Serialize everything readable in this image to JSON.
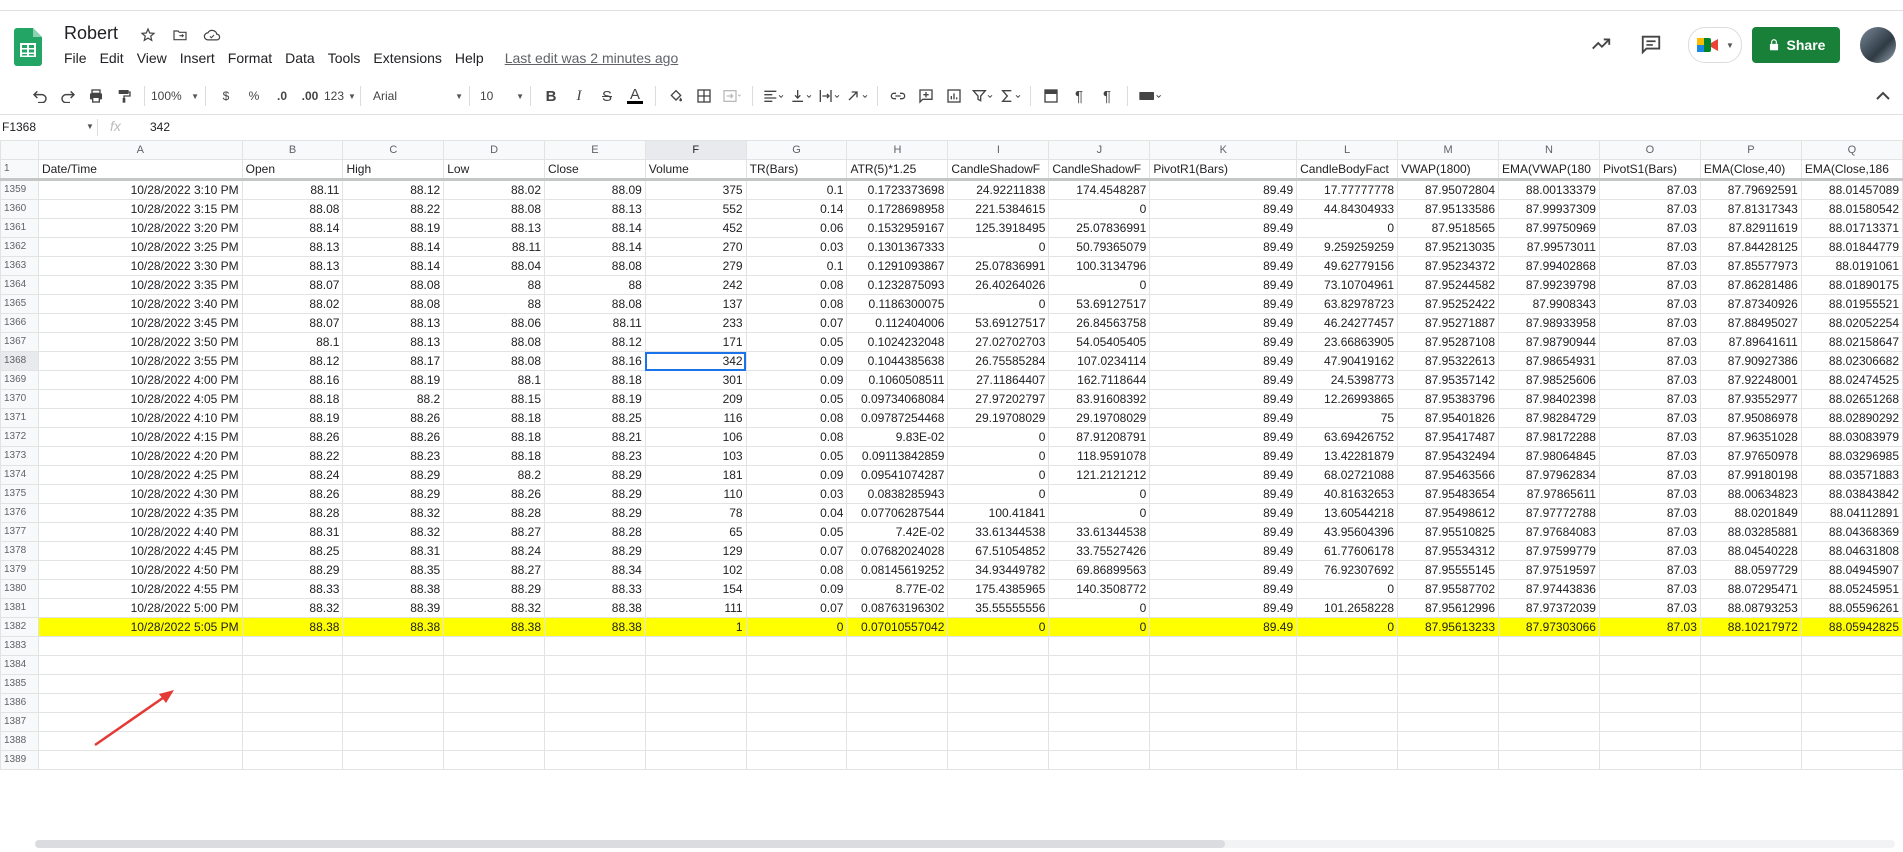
{
  "doc": {
    "title": "Robert",
    "menus": [
      "File",
      "Edit",
      "View",
      "Insert",
      "Format",
      "Data",
      "Tools",
      "Extensions",
      "Help"
    ],
    "last_edit": "Last edit was 2 minutes ago",
    "share_label": "Share"
  },
  "toolbar": {
    "zoom": "100%",
    "currency": "$",
    "percent": "%",
    "dec_decrease": ".0",
    "dec_increase": ".00",
    "more_formats": "123",
    "font": "Arial",
    "font_size": "10"
  },
  "formula_bar": {
    "cell_ref": "F1368",
    "fx": "fx",
    "value": "342"
  },
  "colors": {
    "share_green": "#188038",
    "highlight_yellow": "#ffff00",
    "selection_blue": "#1a73e8",
    "annotation_red": "#e53935"
  },
  "sheet": {
    "column_letters": [
      "A",
      "B",
      "C",
      "D",
      "E",
      "F",
      "G",
      "H",
      "I",
      "J",
      "K",
      "L",
      "M",
      "N",
      "O",
      "P",
      "Q"
    ],
    "header_row_number": "1",
    "headers": [
      "Date/Time",
      "Open",
      "High",
      "Low",
      "Close",
      "Volume",
      "TR(Bars)",
      "ATR(5)*1.25",
      "CandleShadowF",
      "CandleShadowF",
      "PivotR1(Bars)",
      "CandleBodyFact",
      "VWAP(1800)",
      "EMA(VWAP(180",
      "PivotS1(Bars)",
      "EMA(Close,40)",
      "EMA(Close,186"
    ],
    "rows": [
      {
        "n": "1359",
        "c": [
          "10/28/2022 3:10 PM",
          "88.11",
          "88.12",
          "88.02",
          "88.09",
          "375",
          "0.1",
          "0.1723373698",
          "24.92211838",
          "174.4548287",
          "89.49",
          "17.77777778",
          "87.95072804",
          "88.00133379",
          "87.03",
          "87.79692591",
          "88.01457089"
        ]
      },
      {
        "n": "1360",
        "c": [
          "10/28/2022 3:15 PM",
          "88.08",
          "88.22",
          "88.08",
          "88.13",
          "552",
          "0.14",
          "0.1728698958",
          "221.5384615",
          "0",
          "89.49",
          "44.84304933",
          "87.95133586",
          "87.99937309",
          "87.03",
          "87.81317343",
          "88.01580542"
        ]
      },
      {
        "n": "1361",
        "c": [
          "10/28/2022 3:20 PM",
          "88.14",
          "88.19",
          "88.13",
          "88.14",
          "452",
          "0.06",
          "0.1532959167",
          "125.3918495",
          "25.07836991",
          "89.49",
          "0",
          "87.9518565",
          "87.99750969",
          "87.03",
          "87.82911619",
          "88.01713371"
        ]
      },
      {
        "n": "1362",
        "c": [
          "10/28/2022 3:25 PM",
          "88.13",
          "88.14",
          "88.11",
          "88.14",
          "270",
          "0.03",
          "0.1301367333",
          "0",
          "50.79365079",
          "89.49",
          "9.259259259",
          "87.95213035",
          "87.99573011",
          "87.03",
          "87.84428125",
          "88.01844779"
        ]
      },
      {
        "n": "1363",
        "c": [
          "10/28/2022 3:30 PM",
          "88.13",
          "88.14",
          "88.04",
          "88.08",
          "279",
          "0.1",
          "0.1291093867",
          "25.07836991",
          "100.3134796",
          "89.49",
          "49.62779156",
          "87.95234372",
          "87.99402868",
          "87.03",
          "87.85577973",
          "88.0191061"
        ]
      },
      {
        "n": "1364",
        "c": [
          "10/28/2022 3:35 PM",
          "88.07",
          "88.08",
          "88",
          "88",
          "242",
          "0.08",
          "0.1232875093",
          "26.40264026",
          "0",
          "89.49",
          "73.10704961",
          "87.95244582",
          "87.99239798",
          "87.03",
          "87.86281486",
          "88.01890175"
        ]
      },
      {
        "n": "1365",
        "c": [
          "10/28/2022 3:40 PM",
          "88.02",
          "88.08",
          "88",
          "88.08",
          "137",
          "0.08",
          "0.1186300075",
          "0",
          "53.69127517",
          "89.49",
          "63.82978723",
          "87.95252422",
          "87.9908343",
          "87.03",
          "87.87340926",
          "88.01955521"
        ]
      },
      {
        "n": "1366",
        "c": [
          "10/28/2022 3:45 PM",
          "88.07",
          "88.13",
          "88.06",
          "88.11",
          "233",
          "0.07",
          "0.112404006",
          "53.69127517",
          "26.84563758",
          "89.49",
          "46.24277457",
          "87.95271887",
          "87.98933958",
          "87.03",
          "87.88495027",
          "88.02052254"
        ]
      },
      {
        "n": "1367",
        "c": [
          "10/28/2022 3:50 PM",
          "88.1",
          "88.13",
          "88.08",
          "88.12",
          "171",
          "0.05",
          "0.1024232048",
          "27.02702703",
          "54.05405405",
          "89.49",
          "23.66863905",
          "87.95287108",
          "87.98790944",
          "87.03",
          "87.89641611",
          "88.02158647"
        ]
      },
      {
        "n": "1368",
        "c": [
          "10/28/2022 3:55 PM",
          "88.12",
          "88.17",
          "88.08",
          "88.16",
          "342",
          "0.09",
          "0.1044385638",
          "26.75585284",
          "107.0234114",
          "89.49",
          "47.90419162",
          "87.95322613",
          "87.98654931",
          "87.03",
          "87.90927386",
          "88.02306682"
        ]
      },
      {
        "n": "1369",
        "c": [
          "10/28/2022 4:00 PM",
          "88.16",
          "88.19",
          "88.1",
          "88.18",
          "301",
          "0.09",
          "0.1060508511",
          "27.11864407",
          "162.7118644",
          "89.49",
          "24.5398773",
          "87.95357142",
          "87.98525606",
          "87.03",
          "87.92248001",
          "88.02474525"
        ]
      },
      {
        "n": "1370",
        "c": [
          "10/28/2022 4:05 PM",
          "88.18",
          "88.2",
          "88.15",
          "88.19",
          "209",
          "0.05",
          "0.09734068084",
          "27.97202797",
          "83.91608392",
          "89.49",
          "12.26993865",
          "87.95383796",
          "87.98402398",
          "87.03",
          "87.93552977",
          "88.02651268"
        ]
      },
      {
        "n": "1371",
        "c": [
          "10/28/2022 4:10 PM",
          "88.19",
          "88.26",
          "88.18",
          "88.25",
          "116",
          "0.08",
          "0.09787254468",
          "29.19708029",
          "29.19708029",
          "89.49",
          "75",
          "87.95401826",
          "87.98284729",
          "87.03",
          "87.95086978",
          "88.02890292"
        ]
      },
      {
        "n": "1372",
        "c": [
          "10/28/2022 4:15 PM",
          "88.26",
          "88.26",
          "88.18",
          "88.21",
          "106",
          "0.08",
          "9.83E-02",
          "0",
          "87.91208791",
          "89.49",
          "63.69426752",
          "87.95417487",
          "87.98172288",
          "87.03",
          "87.96351028",
          "88.03083979"
        ]
      },
      {
        "n": "1373",
        "c": [
          "10/28/2022 4:20 PM",
          "88.22",
          "88.23",
          "88.18",
          "88.23",
          "103",
          "0.05",
          "0.09113842859",
          "0",
          "118.9591078",
          "89.49",
          "13.42281879",
          "87.95432494",
          "87.98064845",
          "87.03",
          "87.97650978",
          "88.03296985"
        ]
      },
      {
        "n": "1374",
        "c": [
          "10/28/2022 4:25 PM",
          "88.24",
          "88.29",
          "88.2",
          "88.29",
          "181",
          "0.09",
          "0.09541074287",
          "0",
          "121.2121212",
          "89.49",
          "68.02721088",
          "87.95463566",
          "87.97962834",
          "87.03",
          "87.99180198",
          "88.03571883"
        ]
      },
      {
        "n": "1375",
        "c": [
          "10/28/2022 4:30 PM",
          "88.26",
          "88.29",
          "88.26",
          "88.29",
          "110",
          "0.03",
          "0.0838285943",
          "0",
          "0",
          "89.49",
          "40.81632653",
          "87.95483654",
          "87.97865611",
          "87.03",
          "88.00634823",
          "88.03843842"
        ]
      },
      {
        "n": "1376",
        "c": [
          "10/28/2022 4:35 PM",
          "88.28",
          "88.32",
          "88.28",
          "88.29",
          "78",
          "0.04",
          "0.07706287544",
          "100.41841",
          "0",
          "89.49",
          "13.60544218",
          "87.95498612",
          "87.97772788",
          "87.03",
          "88.0201849",
          "88.04112891"
        ]
      },
      {
        "n": "1377",
        "c": [
          "10/28/2022 4:40 PM",
          "88.31",
          "88.32",
          "88.27",
          "88.28",
          "65",
          "0.05",
          "7.42E-02",
          "33.61344538",
          "33.61344538",
          "89.49",
          "43.95604396",
          "87.95510825",
          "87.97684083",
          "87.03",
          "88.03285881",
          "88.04368369"
        ]
      },
      {
        "n": "1378",
        "c": [
          "10/28/2022 4:45 PM",
          "88.25",
          "88.31",
          "88.24",
          "88.29",
          "129",
          "0.07",
          "0.07682024028",
          "67.51054852",
          "33.75527426",
          "89.49",
          "61.77606178",
          "87.95534312",
          "87.97599779",
          "87.03",
          "88.04540228",
          "88.04631808"
        ]
      },
      {
        "n": "1379",
        "c": [
          "10/28/2022 4:50 PM",
          "88.29",
          "88.35",
          "88.27",
          "88.34",
          "102",
          "0.08",
          "0.08145619252",
          "34.93449782",
          "69.86899563",
          "89.49",
          "76.92307692",
          "87.95555145",
          "87.97519597",
          "87.03",
          "88.0597729",
          "88.04945907"
        ]
      },
      {
        "n": "1380",
        "c": [
          "10/28/2022 4:55 PM",
          "88.33",
          "88.38",
          "88.29",
          "88.33",
          "154",
          "0.09",
          "8.77E-02",
          "175.4385965",
          "140.3508772",
          "89.49",
          "0",
          "87.95587702",
          "87.97443836",
          "87.03",
          "88.07295471",
          "88.05245951"
        ]
      },
      {
        "n": "1381",
        "c": [
          "10/28/2022 5:00 PM",
          "88.32",
          "88.39",
          "88.32",
          "88.38",
          "111",
          "0.07",
          "0.08763196302",
          "35.55555556",
          "0",
          "89.49",
          "101.2658228",
          "87.95612996",
          "87.97372039",
          "87.03",
          "88.08793253",
          "88.05596261"
        ]
      },
      {
        "n": "1382",
        "c": [
          "10/28/2022 5:05 PM",
          "88.38",
          "88.38",
          "88.38",
          "88.38",
          "1",
          "0",
          "0.07010557042",
          "0",
          "0",
          "89.49",
          "0",
          "87.95613233",
          "87.97303066",
          "87.03",
          "88.10217972",
          "88.05942825"
        ]
      }
    ],
    "empty_rows": [
      "1383",
      "1384",
      "1385",
      "1386",
      "1387",
      "1388",
      "1389"
    ]
  }
}
